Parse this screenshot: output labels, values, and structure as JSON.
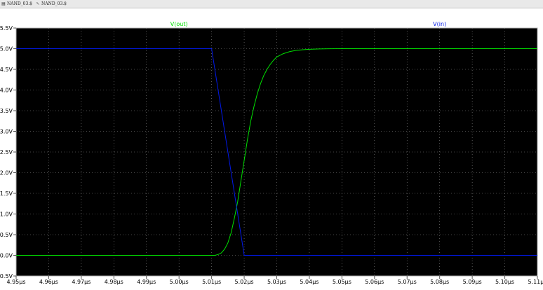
{
  "tabs": [
    {
      "label": "NAND_03.$",
      "icon": "waveform-icon"
    },
    {
      "label": "NAND_03.$",
      "icon": "schematic-icon"
    }
  ],
  "chart_data": {
    "type": "line",
    "background": "#000000",
    "grid": true,
    "grid_color": "#8c8c8c",
    "xlim": [
      4.95,
      5.11
    ],
    "ylim": [
      -0.5,
      5.5
    ],
    "x_tick_labels": [
      "4.95µs",
      "4.96µs",
      "4.97µs",
      "4.98µs",
      "4.99µs",
      "5.00µs",
      "5.01µs",
      "5.02µs",
      "5.03µs",
      "5.04µs",
      "5.05µs",
      "5.06µs",
      "5.07µs",
      "5.08µs",
      "5.09µs",
      "5.10µs",
      "5.11µs"
    ],
    "y_tick_labels": [
      "-0.5V",
      "0.0V",
      "0.5V",
      "1.0V",
      "1.5V",
      "2.0V",
      "2.5V",
      "3.0V",
      "3.5V",
      "4.0V",
      "4.5V",
      "5.0V",
      "5.5V"
    ],
    "series": [
      {
        "name": "V(out)",
        "color": "#00e000",
        "x": [
          4.95,
          5.011,
          5.012,
          5.013,
          5.014,
          5.015,
          5.016,
          5.017,
          5.018,
          5.019,
          5.02,
          5.021,
          5.022,
          5.023,
          5.024,
          5.025,
          5.026,
          5.027,
          5.028,
          5.029,
          5.03,
          5.032,
          5.034,
          5.036,
          5.038,
          5.04,
          5.043,
          5.046,
          5.05,
          5.11
        ],
        "y": [
          0.0,
          0.0,
          0.02,
          0.06,
          0.15,
          0.3,
          0.55,
          0.9,
          1.3,
          1.8,
          2.3,
          2.8,
          3.25,
          3.6,
          3.9,
          4.15,
          4.35,
          4.5,
          4.62,
          4.72,
          4.8,
          4.88,
          4.93,
          4.96,
          4.975,
          4.985,
          4.993,
          4.998,
          5.0,
          5.0
        ]
      },
      {
        "name": "V(in)",
        "color": "#0018e8",
        "x": [
          4.95,
          5.01,
          5.02,
          5.11
        ],
        "y": [
          5.0,
          5.0,
          0.0,
          0.0
        ]
      }
    ]
  }
}
